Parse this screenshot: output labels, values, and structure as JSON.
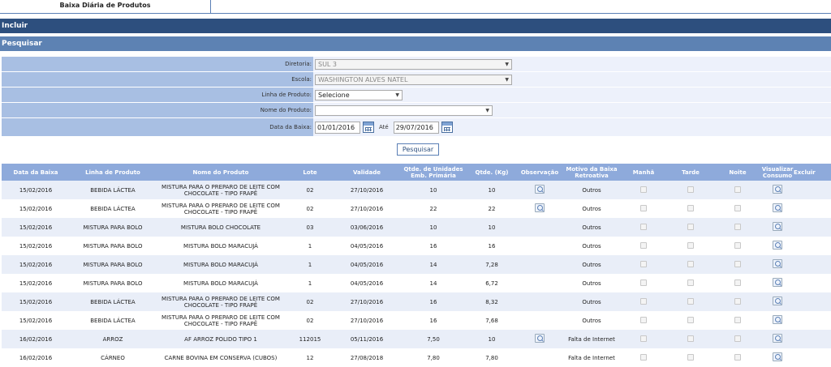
{
  "tab": {
    "label": "Baixa Diária de Produtos"
  },
  "bars": {
    "incluir": "Incluir",
    "pesquisar": "Pesquisar"
  },
  "form": {
    "diretoria": {
      "label": "Diretoria:",
      "value": "SUL 3"
    },
    "escola": {
      "label": "Escola:",
      "value": "WASHINGTON ALVES NATEL"
    },
    "linha": {
      "label": "Linha de Produto:",
      "value": "Selecione"
    },
    "nome": {
      "label": "Nome do Produto:",
      "value": ""
    },
    "data": {
      "label": "Data da Baixa:",
      "from": "01/01/2016",
      "ate": "Até",
      "to": "29/07/2016"
    },
    "search_button": "Pesquisar"
  },
  "table": {
    "headers": [
      "Data da Baixa",
      "Linha de Produto",
      "Nome do Produto",
      "Lote",
      "Validade",
      "Qtde. de Unidades Emb. Primária",
      "Qtde. (Kg)",
      "Observação",
      "Motivo da Baixa Retroativa",
      "Manhã",
      "Tarde",
      "Noite",
      "Visualizar Consumo",
      "Excluir"
    ],
    "rows": [
      {
        "data": "15/02/2016",
        "linha": "BEBIDA LÁCTEA",
        "nome": "MISTURA PARA O PREPARO DE LEITE COM CHOCOLATE - TIPO FRAPÊ",
        "lote": "02",
        "validade": "27/10/2016",
        "qtde_un": "10",
        "qtde_kg": "10",
        "obs": true,
        "motivo": "Outros"
      },
      {
        "data": "15/02/2016",
        "linha": "BEBIDA LÁCTEA",
        "nome": "MISTURA PARA O PREPARO DE LEITE COM CHOCOLATE - TIPO FRAPÊ",
        "lote": "02",
        "validade": "27/10/2016",
        "qtde_un": "22",
        "qtde_kg": "22",
        "obs": true,
        "motivo": "Outros"
      },
      {
        "data": "15/02/2016",
        "linha": "MISTURA PARA BOLO",
        "nome": "MISTURA BOLO CHOCOLATE",
        "lote": "03",
        "validade": "03/06/2016",
        "qtde_un": "10",
        "qtde_kg": "10",
        "obs": false,
        "motivo": "Outros"
      },
      {
        "data": "15/02/2016",
        "linha": "MISTURA PARA BOLO",
        "nome": "MISTURA BOLO MARACUJÁ",
        "lote": "1",
        "validade": "04/05/2016",
        "qtde_un": "16",
        "qtde_kg": "16",
        "obs": false,
        "motivo": "Outros"
      },
      {
        "data": "15/02/2016",
        "linha": "MISTURA PARA BOLO",
        "nome": "MISTURA BOLO MARACUJÁ",
        "lote": "1",
        "validade": "04/05/2016",
        "qtde_un": "14",
        "qtde_kg": "7,28",
        "obs": false,
        "motivo": "Outros"
      },
      {
        "data": "15/02/2016",
        "linha": "MISTURA PARA BOLO",
        "nome": "MISTURA BOLO MARACUJÁ",
        "lote": "1",
        "validade": "04/05/2016",
        "qtde_un": "14",
        "qtde_kg": "6,72",
        "obs": false,
        "motivo": "Outros"
      },
      {
        "data": "15/02/2016",
        "linha": "BEBIDA LÁCTEA",
        "nome": "MISTURA PARA O PREPARO DE LEITE COM CHOCOLATE - TIPO FRAPÊ",
        "lote": "02",
        "validade": "27/10/2016",
        "qtde_un": "16",
        "qtde_kg": "8,32",
        "obs": false,
        "motivo": "Outros"
      },
      {
        "data": "15/02/2016",
        "linha": "BEBIDA LÁCTEA",
        "nome": "MISTURA PARA O PREPARO DE LEITE COM CHOCOLATE - TIPO FRAPÊ",
        "lote": "02",
        "validade": "27/10/2016",
        "qtde_un": "16",
        "qtde_kg": "7,68",
        "obs": false,
        "motivo": "Outros"
      },
      {
        "data": "16/02/2016",
        "linha": "ARROZ",
        "nome": "AF ARROZ POLIDO TIPO 1",
        "lote": "112015",
        "validade": "05/11/2016",
        "qtde_un": "7,50",
        "qtde_kg": "10",
        "obs": true,
        "motivo": "Falta de Internet"
      },
      {
        "data": "16/02/2016",
        "linha": "CÁRNEO",
        "nome": "CARNE BOVINA EM CONSERVA (CUBOS)",
        "lote": "12",
        "validade": "27/08/2018",
        "qtde_un": "7,80",
        "qtde_kg": "7,80",
        "obs": false,
        "motivo": "Falta de Internet"
      }
    ]
  }
}
